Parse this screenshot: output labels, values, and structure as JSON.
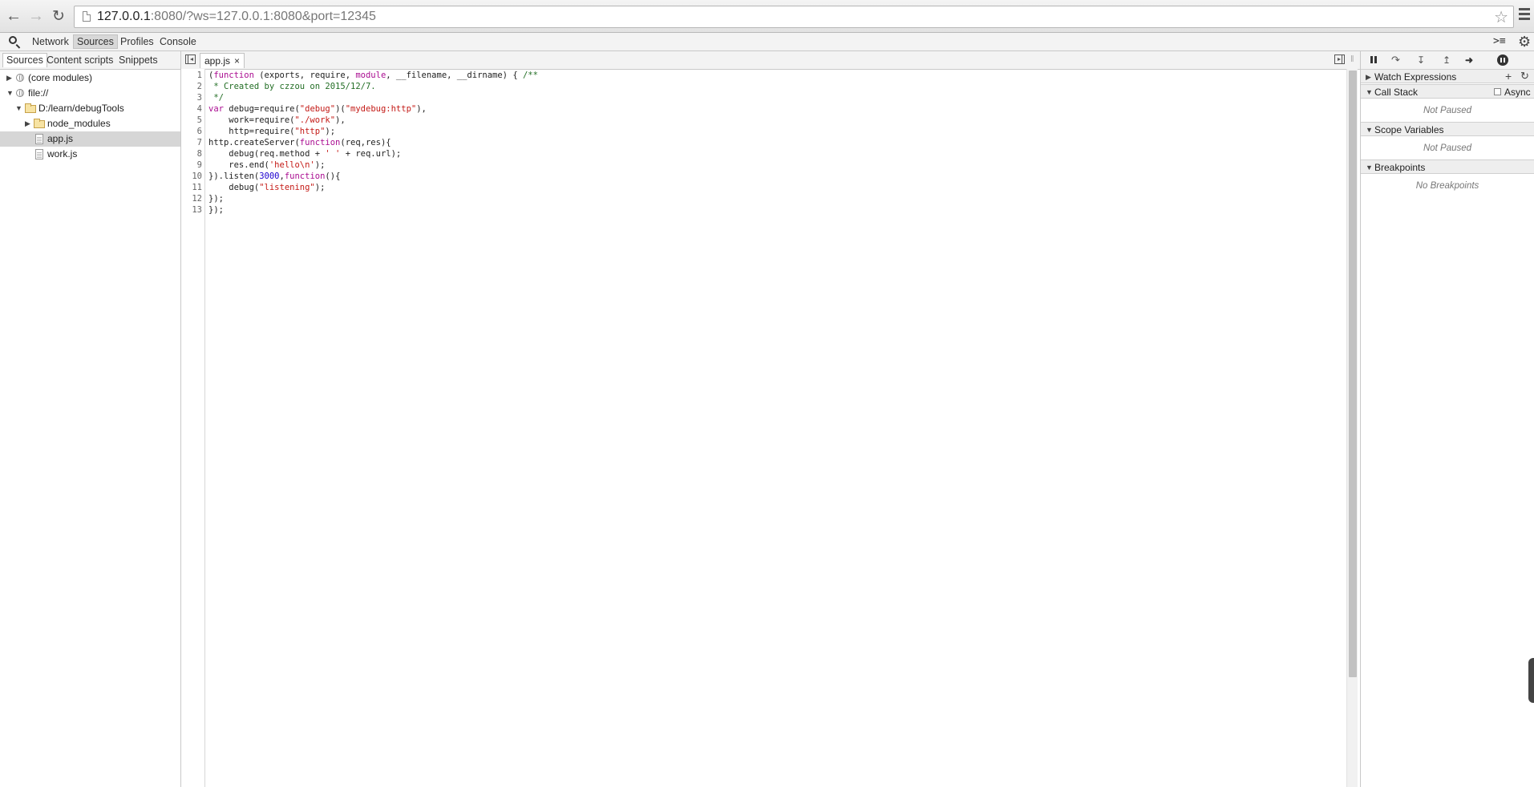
{
  "browser": {
    "url_host": "127.0.0.1",
    "url_rest": ":8080/?ws=127.0.0.1:8080&port=12345",
    "icons": [
      "back-arrow-icon",
      "forward-arrow-icon",
      "reload-icon",
      "page-icon",
      "star-icon",
      "menu-icon"
    ]
  },
  "devtools": {
    "panel_tabs": [
      "Network",
      "Sources",
      "Profiles",
      "Console"
    ],
    "active_panel": "Sources"
  },
  "navigator": {
    "tabs": [
      "Sources",
      "Content scripts",
      "Snippets"
    ],
    "active_tab": "Sources",
    "tree": [
      {
        "label": "(core modules)",
        "type": "origin",
        "expanded": false
      },
      {
        "label": "file://",
        "type": "origin",
        "expanded": true
      },
      {
        "label": "D:/learn/debugTools",
        "type": "folder",
        "expanded": true
      },
      {
        "label": "node_modules",
        "type": "folder",
        "expanded": false
      },
      {
        "label": "app.js",
        "type": "file",
        "selected": true
      },
      {
        "label": "work.js",
        "type": "file",
        "selected": false
      }
    ]
  },
  "editor": {
    "open_tab": "app.js",
    "close_glyph": "×",
    "line_numbers": [
      "1",
      "2",
      "3",
      "4",
      "5",
      "6",
      "7",
      "8",
      "9",
      "10",
      "11",
      "12",
      "13"
    ],
    "lines": [
      [
        {
          "t": "(",
          "c": "plain"
        },
        {
          "t": "function",
          "c": "kw"
        },
        {
          "t": " (exports, require, ",
          "c": "plain"
        },
        {
          "t": "module",
          "c": "kw"
        },
        {
          "t": ", __filename, __dirname) { ",
          "c": "plain"
        },
        {
          "t": "/**",
          "c": "cmt"
        }
      ],
      [
        {
          "t": " * Created by czzou on 2015/12/7.",
          "c": "cmt"
        }
      ],
      [
        {
          "t": " */",
          "c": "cmt"
        }
      ],
      [
        {
          "t": "var",
          "c": "kw"
        },
        {
          "t": " debug=require(",
          "c": "plain"
        },
        {
          "t": "\"debug\"",
          "c": "str"
        },
        {
          "t": ")(",
          "c": "plain"
        },
        {
          "t": "\"mydebug:http\"",
          "c": "str"
        },
        {
          "t": "),",
          "c": "plain"
        }
      ],
      [
        {
          "t": "    work=require(",
          "c": "plain"
        },
        {
          "t": "\"./work\"",
          "c": "str"
        },
        {
          "t": "),",
          "c": "plain"
        }
      ],
      [
        {
          "t": "    http=require(",
          "c": "plain"
        },
        {
          "t": "\"http\"",
          "c": "str"
        },
        {
          "t": ");",
          "c": "plain"
        }
      ],
      [
        {
          "t": "http.createServer(",
          "c": "plain"
        },
        {
          "t": "function",
          "c": "kw"
        },
        {
          "t": "(req,res){",
          "c": "plain"
        }
      ],
      [
        {
          "t": "    debug(req.method + ",
          "c": "plain"
        },
        {
          "t": "' '",
          "c": "str"
        },
        {
          "t": " + req.url);",
          "c": "plain"
        }
      ],
      [
        {
          "t": "    res.end(",
          "c": "plain"
        },
        {
          "t": "'hello\\n'",
          "c": "str"
        },
        {
          "t": ");",
          "c": "plain"
        }
      ],
      [
        {
          "t": "}).listen(",
          "c": "plain"
        },
        {
          "t": "3000",
          "c": "num"
        },
        {
          "t": ",",
          "c": "plain"
        },
        {
          "t": "function",
          "c": "kw"
        },
        {
          "t": "(){",
          "c": "plain"
        }
      ],
      [
        {
          "t": "    debug(",
          "c": "plain"
        },
        {
          "t": "\"listening\"",
          "c": "str"
        },
        {
          "t": ");",
          "c": "plain"
        }
      ],
      [
        {
          "t": "});",
          "c": "plain"
        }
      ],
      [
        {
          "t": "});",
          "c": "plain"
        }
      ]
    ]
  },
  "sidebar": {
    "debug_buttons": [
      "pause-icon",
      "step-over-icon",
      "step-into-icon",
      "step-out-icon",
      "deactivate-breakpoints-icon",
      "pause-on-exceptions-icon"
    ],
    "watch_title": "Watch Expressions",
    "call_stack_title": "Call Stack",
    "async_label": "Async",
    "call_stack_empty": "Not Paused",
    "scope_title": "Scope Variables",
    "scope_empty": "Not Paused",
    "breakpoints_title": "Breakpoints",
    "breakpoints_empty": "No Breakpoints"
  },
  "colors": {
    "keyword": "#aa0d91",
    "string": "#c41a16",
    "comment": "#236e25",
    "number": "#1c00cf"
  }
}
